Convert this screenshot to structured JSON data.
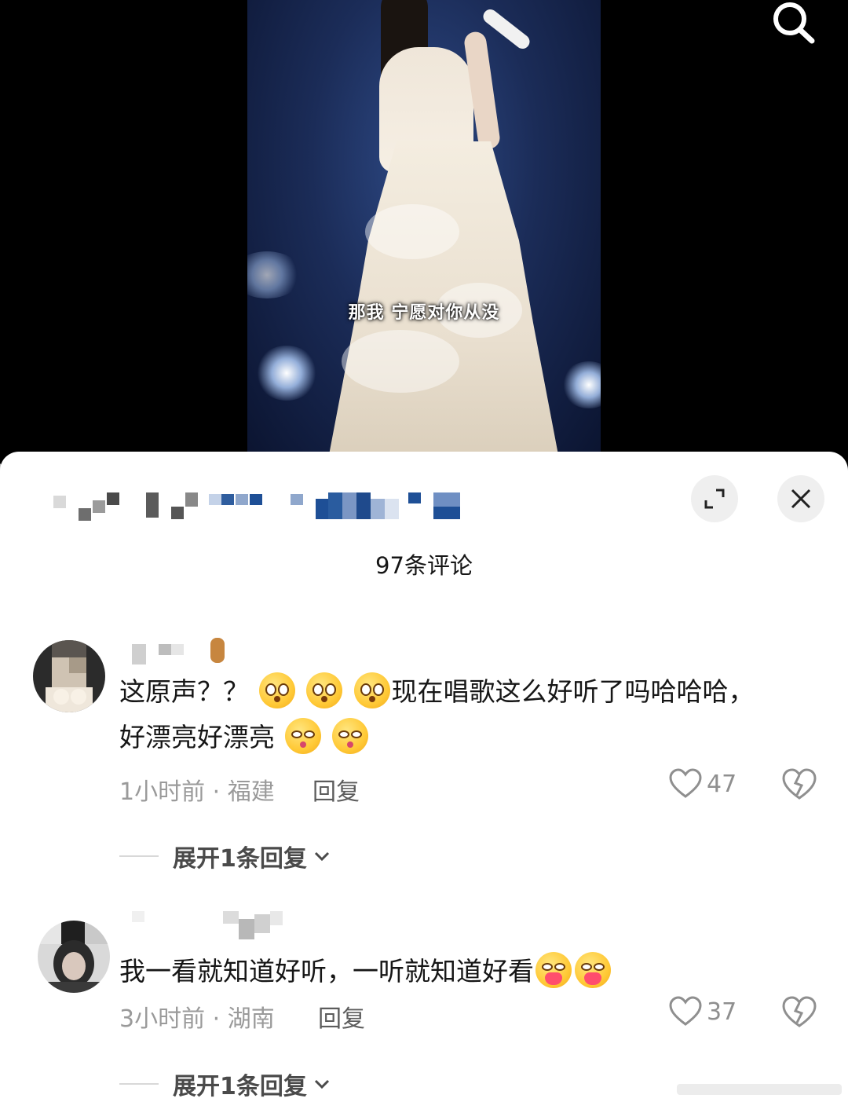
{
  "video": {
    "subtitle": "那我 宁愿对你从没"
  },
  "sheet": {
    "comment_count_title": "97条评论"
  },
  "comments": [
    {
      "text_a": "这原声？？",
      "text_b": "现在唱歌这么好听了吗哈哈哈，",
      "text_c": "好漂亮好漂亮",
      "meta": "1小时前 · 福建",
      "reply_label": "回复",
      "likes": "47",
      "expand_label": "展开1条回复"
    },
    {
      "text_a": "我一看就知道好听，一听就知道好看",
      "meta": "3小时前 · 湖南",
      "reply_label": "回复",
      "likes": "37",
      "expand_label": "展开1条回复"
    }
  ],
  "icons": {
    "search": "search-icon",
    "expand": "expand-icon",
    "close": "close-icon",
    "like": "heart-outline-icon",
    "dislike": "broken-heart-icon",
    "chevron": "chevron-down-icon"
  }
}
